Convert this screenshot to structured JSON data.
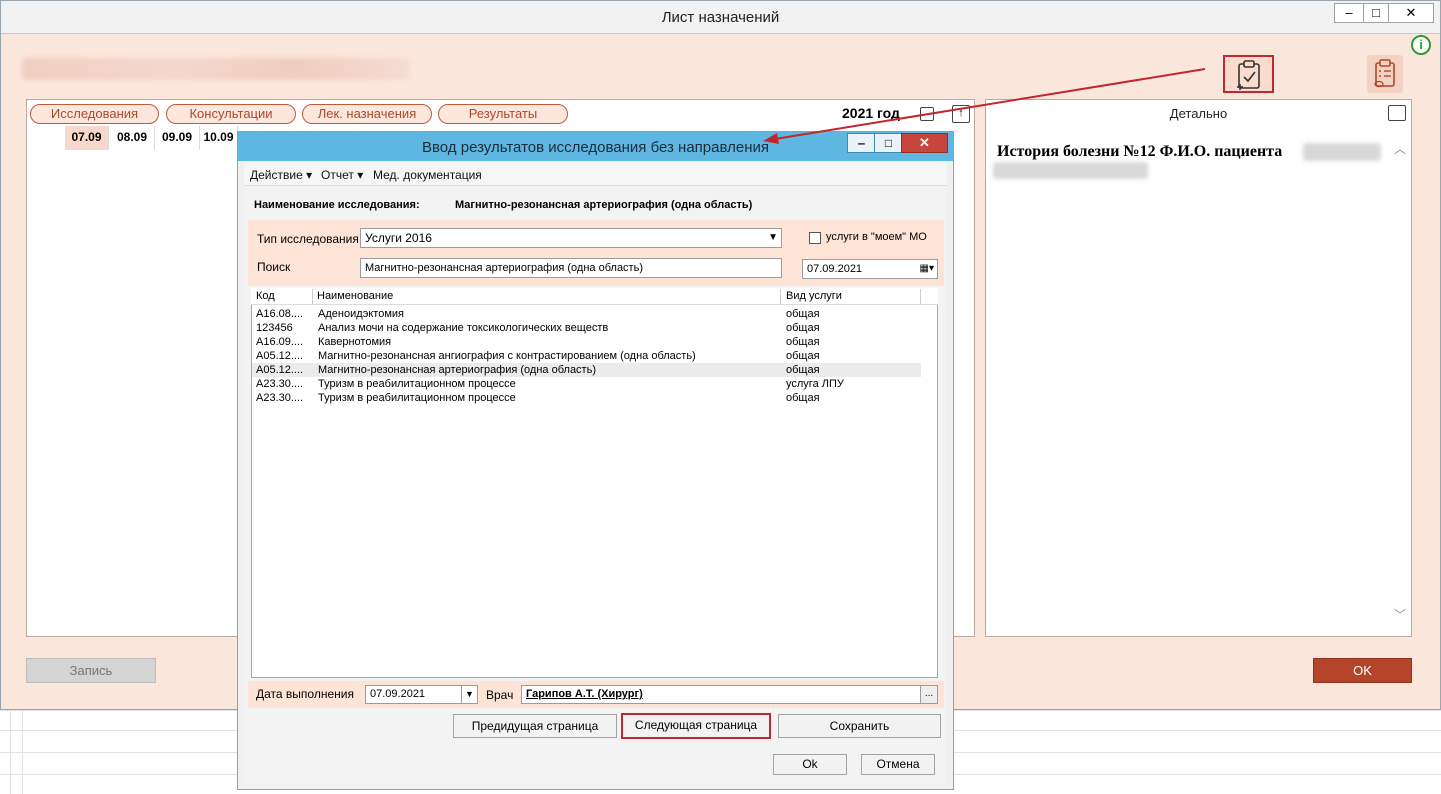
{
  "main_window": {
    "title": "Лист назначений",
    "buttons": {
      "minimize": "‒",
      "maximize": "□",
      "close": "✕"
    },
    "info_icon": "i"
  },
  "tabs": [
    {
      "label": "Исследования"
    },
    {
      "label": "Консультации"
    },
    {
      "label": "Лек. назначения"
    },
    {
      "label": "Результаты"
    }
  ],
  "year_label": "2021 год",
  "dates": [
    "07.09",
    "08.09",
    "09.09",
    "10.09"
  ],
  "detail": {
    "header": "Детально",
    "history_title": "История болезни №12 Ф.И.О. пациента"
  },
  "footer": {
    "record_label": "Запись",
    "ok_label": "OK"
  },
  "dialog": {
    "title": "Ввод результатов исследования без направления",
    "buttons": {
      "minimize": "‒",
      "maximize": "□",
      "close": "✕"
    },
    "menu": [
      "Действие ▾",
      "Отчет ▾",
      "Мед. документация"
    ],
    "study_name_label": "Наименование исследования:",
    "study_name_value": "Магнитно-резонансная артериография (одна область)",
    "type_label": "Тип исследования",
    "type_value": "Услуги 2016",
    "my_mo_label": "услуги в \"моем\" МО",
    "search_label": "Поиск",
    "search_value": "Магнитно-резонансная артериография (одна область)",
    "search_date": "07.09.2021",
    "table": {
      "columns": [
        "Код",
        "Наименование",
        "Вид услуги"
      ],
      "rows": [
        {
          "code": "A16.08....",
          "name": "Аденоидэктомия",
          "kind": "общая"
        },
        {
          "code": "123456",
          "name": "Анализ мочи на содержание токсикологических веществ",
          "kind": "общая"
        },
        {
          "code": "A16.09....",
          "name": "Кавернотомия",
          "kind": "общая"
        },
        {
          "code": "A05.12....",
          "name": "Магнитно-резонансная ангиография с контрастированием (одна область)",
          "kind": "общая"
        },
        {
          "code": "A05.12....",
          "name": "Магнитно-резонансная артериография (одна область)",
          "kind": "общая"
        },
        {
          "code": "A23.30....",
          "name": "Туризм в реабилитационном процессе",
          "kind": "услуга ЛПУ"
        },
        {
          "code": "A23.30....",
          "name": "Туризм в реабилитационном процессе",
          "kind": "общая"
        }
      ]
    },
    "exec_date_label": "Дата выполнения",
    "exec_date_value": "07.09.2021",
    "doctor_label": "Врач",
    "doctor_value": "Гарипов А.Т. (Хирург)",
    "ellipsis": "...",
    "prev_page_label": "Предидущая страница",
    "next_page_label": "Следующая страница",
    "save_label": "Сохранить",
    "ok_label": "Ok",
    "cancel_label": "Отмена"
  },
  "colors": {
    "accent_red": "#c0282e",
    "main_bg": "#fbe6db",
    "dialog_title": "#5db7e0",
    "ok_button": "#b4452b"
  }
}
